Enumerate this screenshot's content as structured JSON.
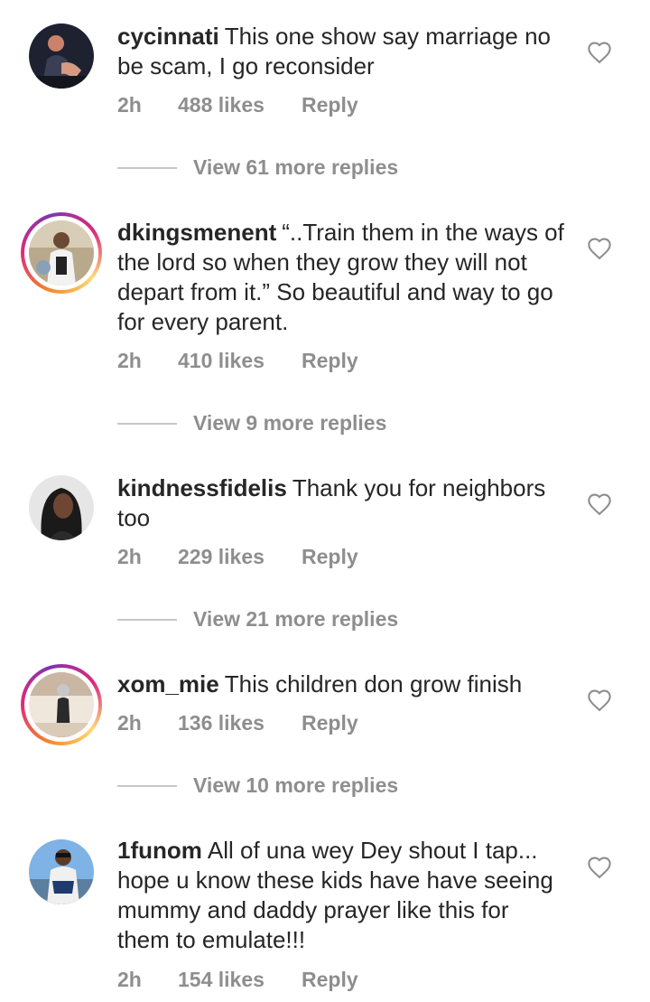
{
  "comments": [
    {
      "username": "cycinnati",
      "text": "This one show say marriage no be scam, I go reconsider",
      "time": "2h",
      "likes": "488 likes",
      "reply": "Reply",
      "view_replies": "View 61 more replies",
      "has_story_ring": false
    },
    {
      "username": "dkingsmenent",
      "text": "“..Train them in the ways of the lord so when they grow they will not depart from it.” So beautiful and way to go for every parent.",
      "time": "2h",
      "likes": "410 likes",
      "reply": "Reply",
      "view_replies": "View 9 more replies",
      "has_story_ring": true
    },
    {
      "username": "kindnessfidelis",
      "text": "Thank you for neighbors too",
      "time": "2h",
      "likes": "229 likes",
      "reply": "Reply",
      "view_replies": "View 21 more replies",
      "has_story_ring": false
    },
    {
      "username": "xom_mie",
      "text": "This children don grow finish",
      "time": "2h",
      "likes": "136 likes",
      "reply": "Reply",
      "view_replies": "View 10 more replies",
      "has_story_ring": true
    },
    {
      "username": "1funom",
      "text": "All of una wey Dey shout I tap... hope u know these kids have have seeing mummy and daddy prayer like this for them to emulate!!!",
      "time": "2h",
      "likes": "154 likes",
      "reply": "Reply",
      "has_story_ring": false
    }
  ],
  "icons": {
    "like": "heart-outline-icon"
  },
  "colors": {
    "text": "#262626",
    "meta": "#8e8e8e",
    "divider": "#c7c7c7"
  }
}
